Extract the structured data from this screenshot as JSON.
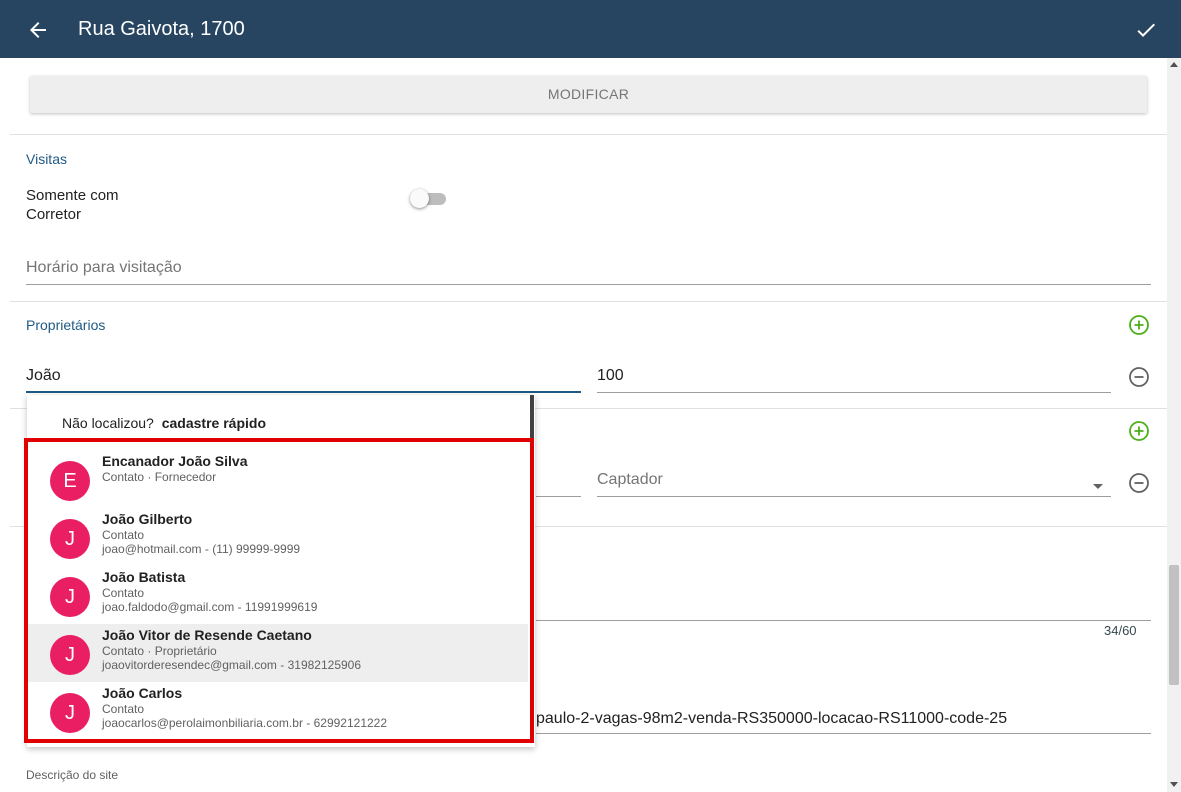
{
  "appbar": {
    "title": "Rua Gaivota, 1700",
    "back_icon": "arrow-left-icon",
    "confirm_icon": "check-icon"
  },
  "colors": {
    "appbar_bg": "#274560",
    "section_title": "#1f5a84",
    "avatar_bg": "#e91e63",
    "add_icon": "#4caf1a",
    "highlight": "#e00000"
  },
  "actions": {
    "modify_label": "MODIFICAR"
  },
  "visitas": {
    "title": "Visitas",
    "only_with_broker_line1": "Somente com",
    "only_with_broker_line2": "Corretor",
    "only_with_broker_on": false,
    "visit_hours_placeholder": "Horário para visitação"
  },
  "proprietarios": {
    "title": "Proprietários",
    "owner_input_value": "João",
    "share_value": "100"
  },
  "captador": {
    "placeholder": "Captador"
  },
  "title_counter": "34/60",
  "url_value": "paulo-2-vagas-98m2-venda-RS350000-locacao-RS11000-code-25",
  "site_description_label": "Descrição do site",
  "autocomplete": {
    "not_found_text": "Não localizou?",
    "quick_register_link": "cadastre rápido",
    "results": [
      {
        "initial": "E",
        "name": "Encanador João Silva",
        "sub1": "Contato · Fornecedor",
        "sub2": ""
      },
      {
        "initial": "J",
        "name": "João Gilberto",
        "sub1": "Contato",
        "sub2": "joao@hotmail.com - (11) 99999-9999"
      },
      {
        "initial": "J",
        "name": "João Batista",
        "sub1": "Contato",
        "sub2": "joao.faldodo@gmail.com - 11991999619"
      },
      {
        "initial": "J",
        "name": "João Vitor de Resende Caetano",
        "sub1": "Contato · Proprietário",
        "sub2": "joaovitorderesendec@gmail.com - 31982125906"
      },
      {
        "initial": "J",
        "name": "João Carlos",
        "sub1": "Contato",
        "sub2": "joaocarlos@perolaimonbiliaria.com.br - 62992121222"
      }
    ]
  }
}
